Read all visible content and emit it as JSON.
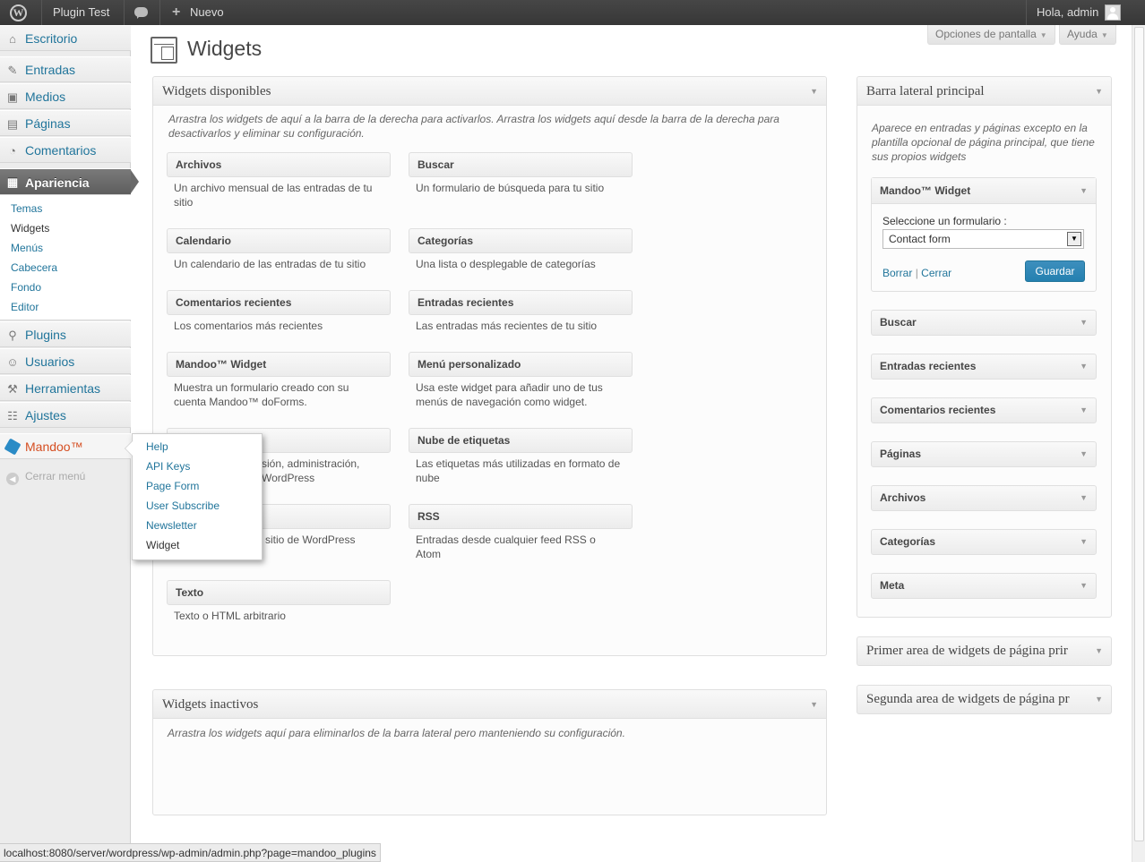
{
  "adminbar": {
    "site": "Plugin Test",
    "new": "Nuevo",
    "greeting": "Hola, admin"
  },
  "menu": {
    "items": [
      {
        "label": "Escritorio",
        "icon": "dashboard-icon"
      },
      {
        "label": "Entradas",
        "icon": "pin-icon"
      },
      {
        "label": "Medios",
        "icon": "media-icon"
      },
      {
        "label": "Páginas",
        "icon": "pages-icon"
      },
      {
        "label": "Comentarios",
        "icon": "comments-icon"
      },
      {
        "label": "Apariencia",
        "icon": "appearance-icon"
      },
      {
        "label": "Plugins",
        "icon": "plugins-icon"
      },
      {
        "label": "Usuarios",
        "icon": "users-icon"
      },
      {
        "label": "Herramientas",
        "icon": "tools-icon"
      },
      {
        "label": "Ajustes",
        "icon": "settings-icon"
      },
      {
        "label": "Mandoo™",
        "icon": "mandoo-icon"
      }
    ],
    "appearance_sub": [
      "Temas",
      "Widgets",
      "Menús",
      "Cabecera",
      "Fondo",
      "Editor"
    ],
    "collapse": "Cerrar menú"
  },
  "flyout": [
    "Help",
    "API Keys",
    "Page Form",
    "User Subscribe",
    "Newsletter",
    "Widget"
  ],
  "header": {
    "title": "Widgets",
    "screen_options": "Opciones de pantalla",
    "help": "Ayuda"
  },
  "available": {
    "title": "Widgets disponibles",
    "description": "Arrastra los widgets de aquí a la barra de la derecha para activarlos. Arrastra los widgets aquí desde la barra de la derecha para desactivarlos y eliminar su configuración.",
    "widgets": [
      {
        "title": "Archivos",
        "desc": "Un archivo mensual de las entradas de tu sitio"
      },
      {
        "title": "Buscar",
        "desc": "Un formulario de búsqueda para tu sitio"
      },
      {
        "title": "Calendario",
        "desc": "Un calendario de las entradas de tu sitio"
      },
      {
        "title": "Categorías",
        "desc": "Una lista o desplegable de categorías"
      },
      {
        "title": "Comentarios recientes",
        "desc": "Los comentarios más recientes"
      },
      {
        "title": "Entradas recientes",
        "desc": "Las entradas más recientes de tu sitio"
      },
      {
        "title": "Mandoo™ Widget",
        "desc": "Muestra un formulario creado con su cuenta Mandoo™ doForms."
      },
      {
        "title": "Menú personalizado",
        "desc": "Usa este widget para añadir uno de tus menús de navegación como widget."
      },
      {
        "title": "",
        "desc": "sión, administración, WordPress"
      },
      {
        "title": "Nube de etiquetas",
        "desc": "Las etiquetas más utilizadas en formato de nube"
      },
      {
        "title": "",
        "desc": "sitio de WordPress"
      },
      {
        "title": "RSS",
        "desc": "Entradas desde cualquier feed RSS o Atom"
      },
      {
        "title": "Texto",
        "desc": "Texto o HTML arbitrario"
      }
    ]
  },
  "inactive": {
    "title": "Widgets inactivos",
    "description": "Arrastra los widgets aquí para eliminarlos de la barra lateral pero manteniendo su configuración."
  },
  "sidebar": {
    "title": "Barra lateral principal",
    "description": "Aparece en entradas y páginas excepto en la plantilla opcional de página principal, que tiene sus propios widgets",
    "mandoo": {
      "title": "Mandoo™ Widget",
      "label": "Seleccione un formulario :",
      "selected": "Contact form",
      "delete": "Borrar",
      "sep": "|",
      "close": "Cerrar",
      "save": "Guardar"
    },
    "widgets": [
      "Buscar",
      "Entradas recientes",
      "Comentarios recientes",
      "Páginas",
      "Archivos",
      "Categorías",
      "Meta"
    ]
  },
  "other_sidebars": [
    "Primer area de widgets de página prir",
    "Segunda area de widgets de página pr"
  ],
  "status_url": "localhost:8080/server/wordpress/wp-admin/admin.php?page=mandoo_plugins",
  "colors": {
    "link": "#21759b",
    "mandoo": "#d54e21",
    "primary_button": "#2480b0"
  }
}
